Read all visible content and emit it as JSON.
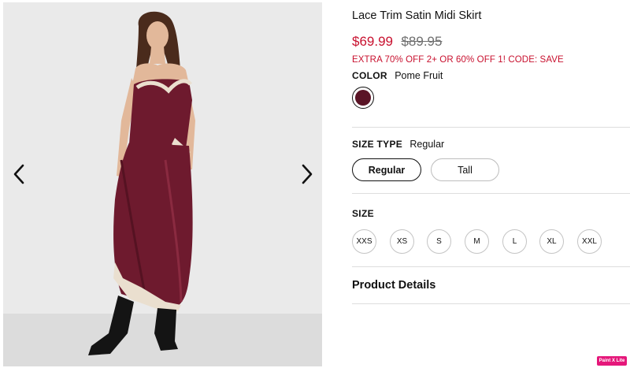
{
  "product": {
    "title": "Lace Trim Satin Midi Skirt",
    "sale_price": "$69.99",
    "original_price": "$89.95",
    "promo": "EXTRA 70% OFF 2+ OR 60% OFF 1! CODE: SAVE"
  },
  "color": {
    "label": "COLOR",
    "value": "Pome Fruit",
    "swatch_hex": "#5a1426"
  },
  "size_type": {
    "label": "SIZE TYPE",
    "value": "Regular",
    "options": [
      "Regular",
      "Tall"
    ],
    "selected": "Regular"
  },
  "size": {
    "label": "SIZE",
    "options": [
      "XXS",
      "XS",
      "S",
      "M",
      "L",
      "XL",
      "XXL"
    ]
  },
  "details": {
    "label": "Product Details"
  },
  "gallery": {
    "prev_icon": "chevron-left-icon",
    "next_icon": "chevron-right-icon"
  },
  "badge": {
    "text": "Paint X Lite"
  },
  "theme": {
    "sale_color": "#c8102e",
    "garment_color": "#6e1a2e"
  }
}
